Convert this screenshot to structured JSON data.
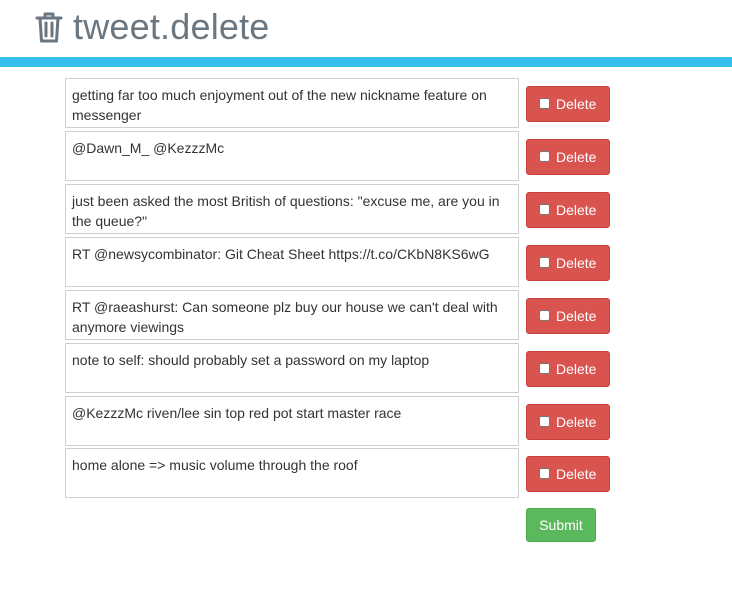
{
  "header": {
    "title": "tweet.delete",
    "icon": "trash-icon",
    "accent_color": "#34c0ea"
  },
  "tweets": [
    {
      "text": "getting far too much enjoyment out of the new nickname feature on messenger",
      "delete_label": "Delete"
    },
    {
      "text": "@Dawn_M_ @KezzzMc",
      "delete_label": "Delete"
    },
    {
      "text": "just been asked the most British of questions: \"excuse me, are you in the queue?\"",
      "delete_label": "Delete"
    },
    {
      "text": "RT @newsycombinator: Git Cheat Sheet https://t.co/CKbN8KS6wG",
      "delete_label": "Delete"
    },
    {
      "text": "RT @raeashurst: Can someone plz buy our house we can't deal with anymore viewings",
      "delete_label": "Delete"
    },
    {
      "text": "note to self: should probably set a password on my laptop",
      "delete_label": "Delete"
    },
    {
      "text": "@KezzzMc riven/lee sin top red pot start master race",
      "delete_label": "Delete"
    },
    {
      "text": "home alone => music volume through the roof",
      "delete_label": "Delete"
    }
  ],
  "submit_label": "Submit",
  "colors": {
    "delete": "#d9534f",
    "submit": "#5cb85c"
  }
}
